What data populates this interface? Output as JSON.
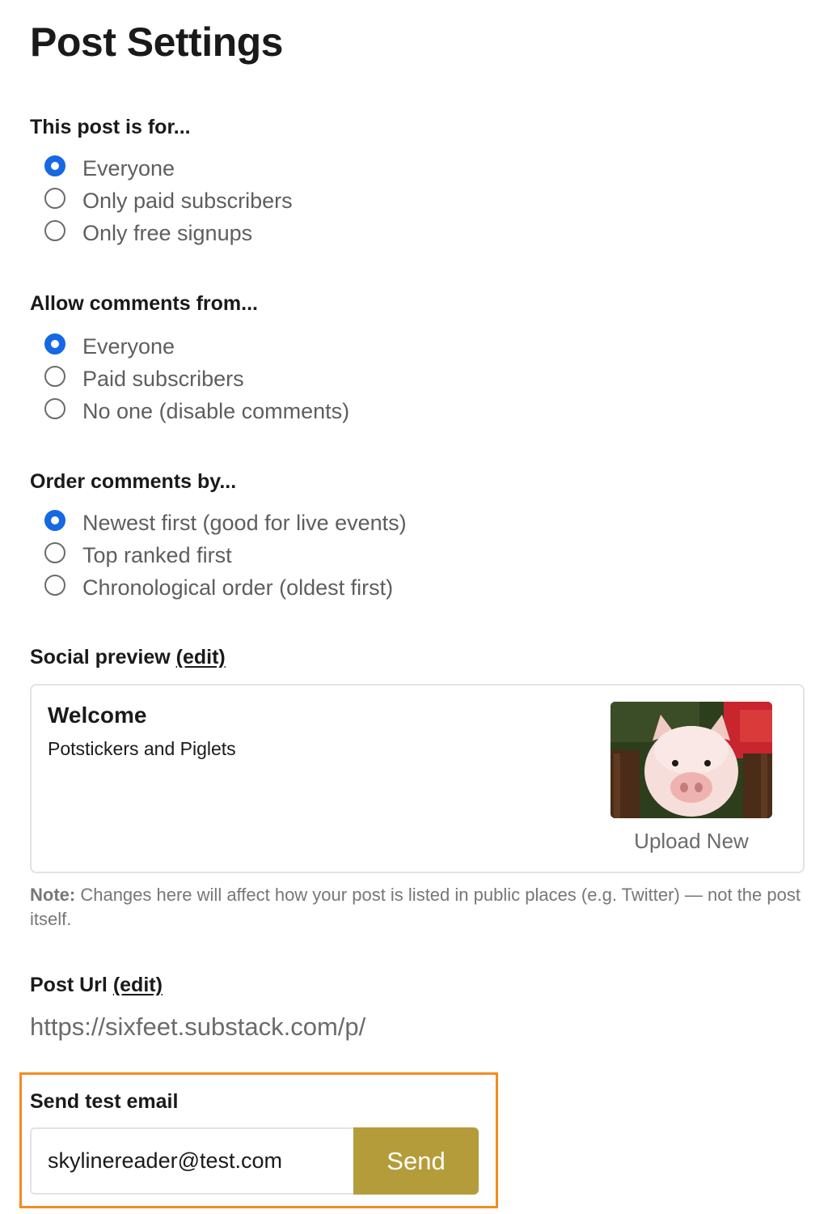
{
  "page": {
    "title": "Post Settings"
  },
  "audience": {
    "heading": "This post is for...",
    "options": [
      {
        "label": "Everyone",
        "checked": true
      },
      {
        "label": "Only paid subscribers",
        "checked": false
      },
      {
        "label": "Only free signups",
        "checked": false
      }
    ]
  },
  "comments": {
    "heading": "Allow comments from...",
    "options": [
      {
        "label": "Everyone",
        "checked": true
      },
      {
        "label": "Paid subscribers",
        "checked": false
      },
      {
        "label": "No one (disable comments)",
        "checked": false
      }
    ]
  },
  "order": {
    "heading": "Order comments by...",
    "options": [
      {
        "label": "Newest first (good for live events)",
        "checked": true
      },
      {
        "label": "Top ranked first",
        "checked": false
      },
      {
        "label": "Chronological order (oldest first)",
        "checked": false
      }
    ]
  },
  "social_preview": {
    "heading": "Social preview",
    "edit_label": "(edit)",
    "card_title": "Welcome",
    "card_subtitle": "Potstickers and Piglets",
    "image_icon": "piglet-photo",
    "upload_label": "Upload New",
    "note_label": "Note:",
    "note_text": " Changes here will affect how your post is listed in public places (e.g. Twitter) — not the post itself."
  },
  "post_url": {
    "heading": "Post Url",
    "edit_label": "(edit)",
    "value": "https://sixfeet.substack.com/p/"
  },
  "test_email": {
    "heading": "Send test email",
    "email_value": "skylinereader@test.com",
    "send_label": "Send"
  },
  "colors": {
    "radio_checked": "#1668e3",
    "send_button": "#b59c3a",
    "highlight_border": "#f58a1f"
  }
}
